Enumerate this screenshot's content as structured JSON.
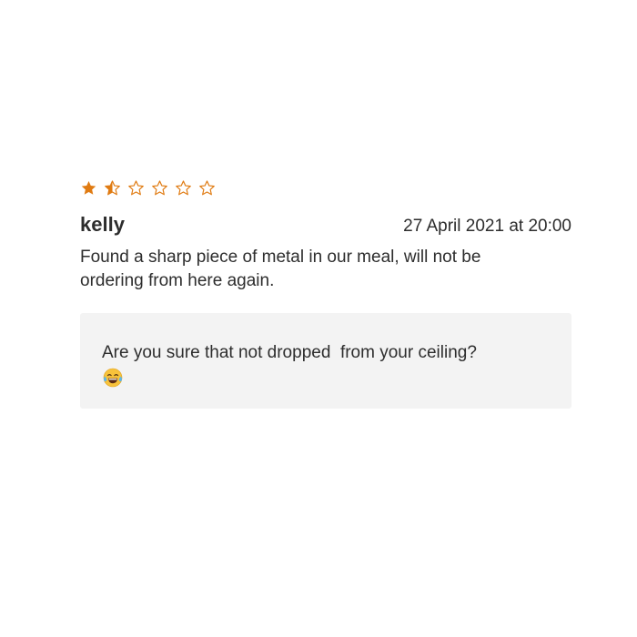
{
  "review": {
    "rating": 1.5,
    "rating_max": 6,
    "star_color": "#e07b12",
    "author": "kelly",
    "date": "27 April 2021 at 20:00",
    "body": "Found a sharp piece of metal in our meal, will not be ordering from here again."
  },
  "reply": {
    "text": "Are you sure that not dropped  from your ceiling?",
    "emoji": "tears-of-joy-emoji"
  }
}
